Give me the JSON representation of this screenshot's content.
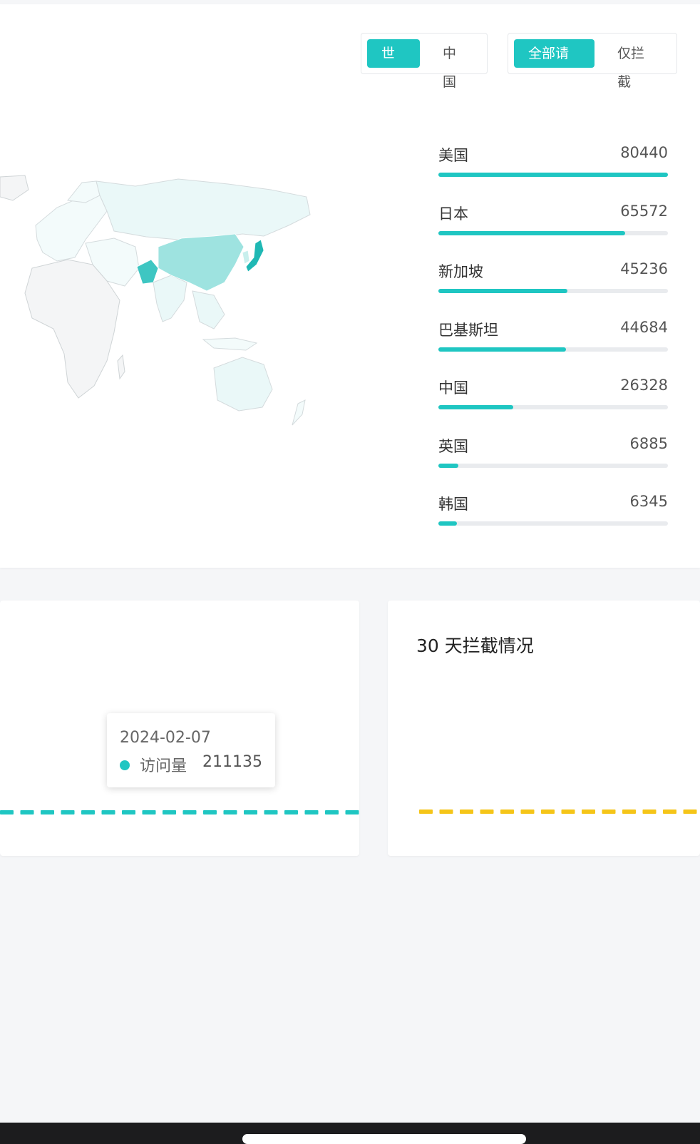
{
  "filters": {
    "region": [
      {
        "label": "世界",
        "active": true
      },
      {
        "label": "中国",
        "active": false
      }
    ],
    "requests": [
      {
        "label": "全部请求",
        "active": true
      },
      {
        "label": "仅拦截",
        "active": false
      }
    ]
  },
  "map": {
    "highlight_color": "#1fc6c2",
    "light_color": "#e8f7f7"
  },
  "ranking": [
    {
      "name": "美国",
      "value": 80440
    },
    {
      "name": "日本",
      "value": 65572
    },
    {
      "name": "新加坡",
      "value": 45236
    },
    {
      "name": "巴基斯坦",
      "value": 44684
    },
    {
      "name": "中国",
      "value": 26328
    },
    {
      "name": "英国",
      "value": 6885
    },
    {
      "name": "韩国",
      "value": 6345
    }
  ],
  "access_card": {
    "tooltip": {
      "date": "2024-02-07",
      "label": "访问量",
      "value": "211135"
    }
  },
  "block_card": {
    "title": "30 天拦截情况"
  },
  "chart_data": [
    {
      "type": "bar",
      "categories": [],
      "values": [
        3,
        3,
        3,
        3,
        3,
        3,
        3,
        3,
        3,
        3,
        3,
        3,
        3,
        3,
        3,
        3,
        3,
        3,
        3,
        3,
        22000,
        3,
        3,
        211135,
        9000
      ],
      "title": "",
      "color": "#1fc6c2",
      "highlight_color": "#3bdada",
      "max": 211135
    },
    {
      "type": "bar",
      "categories": [],
      "values": [
        0,
        0,
        0,
        0,
        0,
        0,
        0,
        0,
        0,
        0,
        0,
        0,
        0,
        0
      ],
      "title": "30 天拦截情况",
      "color": "#f5c518"
    }
  ]
}
